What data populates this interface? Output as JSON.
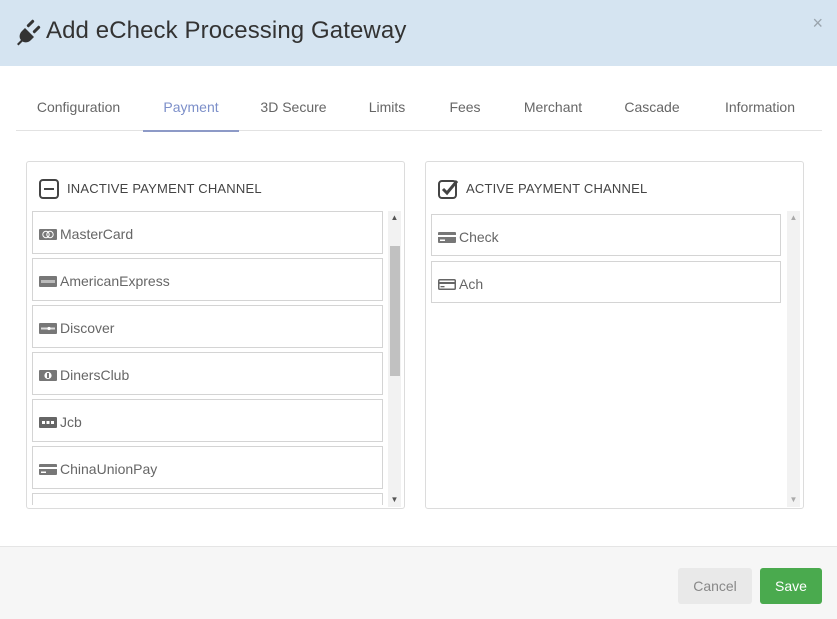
{
  "header": {
    "title": "Add eCheck Processing Gateway",
    "close_label": "×"
  },
  "tabs": [
    {
      "label": "Configuration"
    },
    {
      "label": "Payment"
    },
    {
      "label": "3D Secure"
    },
    {
      "label": "Limits"
    },
    {
      "label": "Fees"
    },
    {
      "label": "Merchant"
    },
    {
      "label": "Cascade"
    },
    {
      "label": "Information"
    }
  ],
  "active_tab": "Payment",
  "inactive_panel": {
    "title": "INACTIVE PAYMENT CHANNEL",
    "items": [
      {
        "label": "MasterCard",
        "icon": "mastercard-icon"
      },
      {
        "label": "AmericanExpress",
        "icon": "amex-icon"
      },
      {
        "label": "Discover",
        "icon": "discover-icon"
      },
      {
        "label": "DinersClub",
        "icon": "dinersclub-icon"
      },
      {
        "label": "Jcb",
        "icon": "jcb-icon"
      },
      {
        "label": "ChinaUnionPay",
        "icon": "credit-card-icon"
      },
      {
        "label": "",
        "icon": ""
      }
    ]
  },
  "active_panel": {
    "title": "ACTIVE PAYMENT CHANNEL",
    "items": [
      {
        "label": "Check",
        "icon": "credit-card-icon"
      },
      {
        "label": "Ach",
        "icon": "credit-card-outline-icon"
      }
    ]
  },
  "footer": {
    "cancel_label": "Cancel",
    "save_label": "Save"
  },
  "colors": {
    "header_bg": "#d5e4f1",
    "active_tab": "#7c8fc9",
    "save": "#4aaa4e"
  }
}
